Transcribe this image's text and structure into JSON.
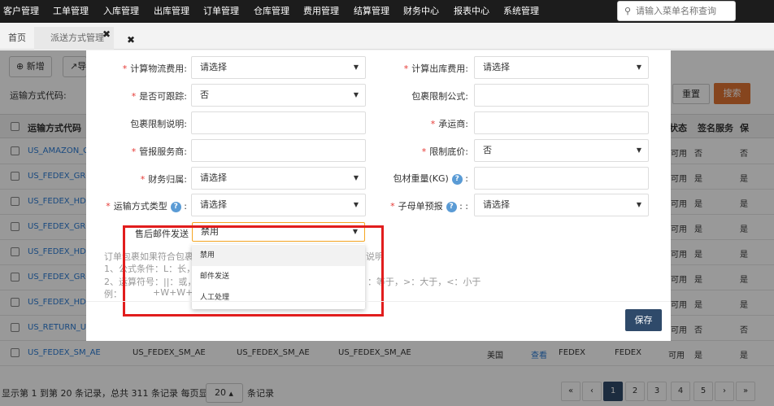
{
  "topnav": {
    "items": [
      "客户管理",
      "工单管理",
      "入库管理",
      "出库管理",
      "订单管理",
      "仓库管理",
      "费用管理",
      "结算管理",
      "财务中心",
      "报表中心",
      "系统管理"
    ],
    "search_placeholder": "请输入菜单名称查询",
    "search_icon": "search-icon"
  },
  "tabs": {
    "home": "首页",
    "current": "派送方式管理",
    "close": "✖"
  },
  "background": {
    "add_button": "新增",
    "other_button": "导",
    "filter_label": "运输方式代码:",
    "filter_placeholder": "多",
    "reset_button": "重置",
    "search_button": "搜索",
    "columns": [
      "运输方式代码",
      "状态",
      "签名服务",
      "保"
    ],
    "rows": [
      {
        "code": "US_AMAZON_GR",
        "status": "可用",
        "sign": "否",
        "ins": "否"
      },
      {
        "code": "US_FEDEX_GROU",
        "status": "可用",
        "sign": "是",
        "ins": "是"
      },
      {
        "code": "US_FEDEX_HD_O",
        "status": "可用",
        "sign": "是",
        "ins": "是"
      },
      {
        "code": "US_FEDEX_GROU",
        "status": "可用",
        "sign": "是",
        "ins": "是"
      },
      {
        "code": "US_FEDEX_HD_LC",
        "status": "可用",
        "sign": "是",
        "ins": "是"
      },
      {
        "code": "US_FEDEX_GROU",
        "status": "可用",
        "sign": "是",
        "ins": "是"
      },
      {
        "code": "US_FEDEX_HD_A",
        "status": "可用",
        "sign": "是",
        "ins": "是"
      },
      {
        "code": "US_RETURN_UPS",
        "status": "可用",
        "sign": "否",
        "ins": "否"
      },
      {
        "code": "US_FEDEX_SM_AE",
        "code2": "US_FEDEX_SM_AE",
        "code3": "US_FEDEX_SM_AE",
        "code4": "US_FEDEX_SM_AE",
        "country": "美国",
        "view": "查看",
        "carrier": "FEDEX",
        "carrier2": "FEDEX",
        "status": "可用",
        "sign": "是",
        "ins": "是"
      }
    ],
    "footer_info": "显示第 1 到第 20 条记录，总共 311 条记录 每页显示",
    "page_size": "20",
    "page_size_caret": "▲",
    "page_size_suffix": "条记录",
    "pager": [
      "«",
      "‹",
      "1",
      "2",
      "3",
      "4",
      "5",
      "›",
      "»"
    ]
  },
  "modal": {
    "fields": {
      "logistics_fee_label": "计算物流费用:",
      "logistics_fee_value": "请选择",
      "outbound_fee_label": "计算出库费用:",
      "outbound_fee_value": "请选择",
      "trackable_label": "是否可跟踪:",
      "trackable_value": "否",
      "pkg_formula_label": "包裹限制公式:",
      "pkg_desc_label": "包裹限制说明:",
      "carrier_label": "承运商:",
      "declare_label": "管报服务商:",
      "min_price_label": "限制底价:",
      "min_price_value": "否",
      "finance_label": "财务归属:",
      "finance_value": "请选择",
      "pkg_weight_label": "包材重量(KG)",
      "transport_type_label": "运输方式类型",
      "transport_type_value": "请选择",
      "parent_child_label": "子母单预报",
      "parent_child_value": "请选择",
      "aftersale_label": "售后邮件发送",
      "aftersale_value": "禁用"
    },
    "dropdown_options": [
      "禁用",
      "邮件发送",
      "人工处理"
    ],
    "notes": {
      "line1": "订单包裹如果符合包裹",
      "line1_suffix": "说明",
      "line2": "1、公式条件：L：长，",
      "line3": "2、运算符号：||：或，",
      "line3_suffix": "：等于，>：大于，<：小于",
      "line4": "例：",
      "line4_suffix": "+W+W+H+H>3"
    },
    "save_button": "保存"
  }
}
